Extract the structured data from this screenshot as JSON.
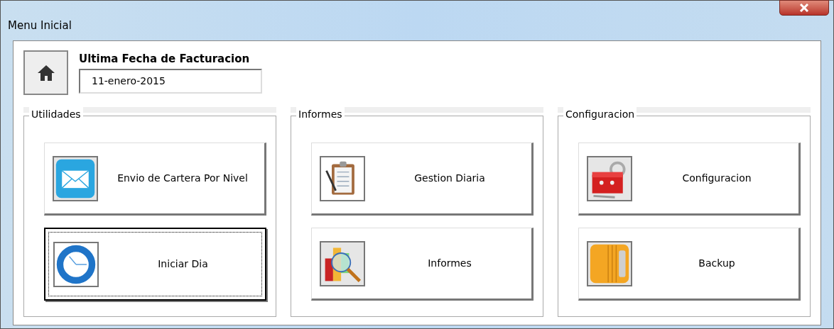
{
  "window": {
    "title": "Menu Inicial"
  },
  "header": {
    "label": "Ultima Fecha de Facturacion",
    "date_value": "11-enero-2015"
  },
  "groups": [
    {
      "title": "Utilidades",
      "buttons": [
        {
          "label": "Envio de Cartera Por Nivel",
          "focused": false
        },
        {
          "label": "Iniciar Dia",
          "focused": true
        }
      ]
    },
    {
      "title": "Informes",
      "buttons": [
        {
          "label": "Gestion Diaria",
          "focused": false
        },
        {
          "label": "Informes",
          "focused": false
        }
      ]
    },
    {
      "title": "Configuracion",
      "buttons": [
        {
          "label": "Configuracion",
          "focused": false
        },
        {
          "label": "Backup",
          "focused": false
        }
      ]
    }
  ]
}
